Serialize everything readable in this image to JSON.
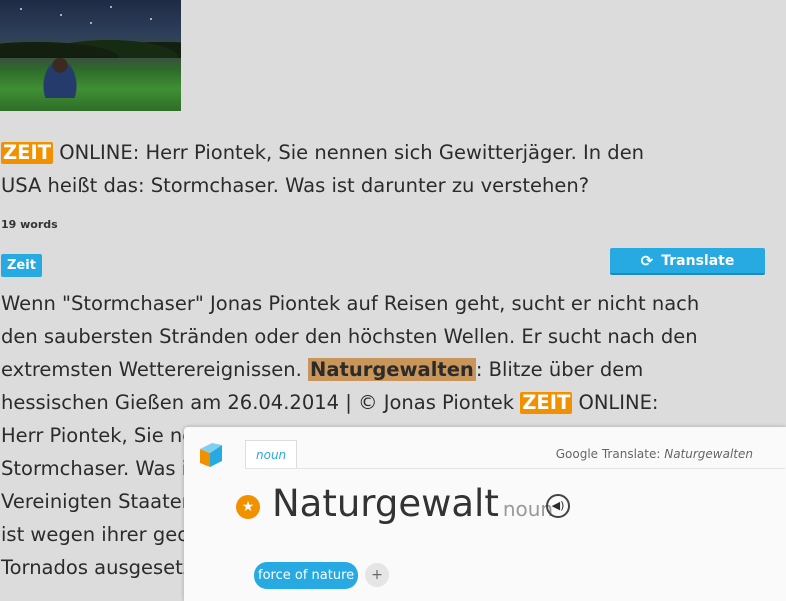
{
  "logo_text": "ZEIT",
  "intro": {
    "after_logo": "ONLINE: Herr Piontek, Sie nennen sich Gewitterjäger. In den USA heißt das: Stormchaser. Was ist darunter zu verstehen?"
  },
  "word_count": "19 words",
  "tag": "Zeit",
  "translate_button": "Translate",
  "article": {
    "part1": "Wenn \"Stormchaser\" Jonas Piontek auf Reisen geht, sucht er nicht nach den saubersten Stränden oder den höchsten Wellen. Er sucht nach den extremsten Wetterereignissen. ",
    "highlight": "Naturgewalten",
    "part2": ": Blitze über dem hessischen Gießen am 26.04.2014  |  © Jonas Piontek ",
    "part3": " ONLINE: Herr Piontek, Sie nennen sich Gewitterjäger. In den USA heißt das: Stormchaser. Was ist darunter zu verstehen? Der Begriff wurde in den Vereinigten Staaten geprägt, speziell im Mittleren Westen. Die Gegend ist wegen ihrer geografischen Lage häufig zu schweren Unwettern und Tornados ausgesetzt. Ein Stormchaser beschäftigt sich"
  },
  "popup": {
    "tab_label": "noun",
    "source_prefix": "Google Translate: ",
    "source_word": "Naturgewalten",
    "headword": "Naturgewalt",
    "part_of_speech": "noun",
    "translation": "force of nature",
    "add_symbol": "+",
    "icons": {
      "logo": "book-logo-icon",
      "star": "star-icon",
      "audio": "speaker-icon",
      "translate": "refresh-icon"
    }
  },
  "colors": {
    "accent": "#27aae1",
    "zeit_orange": "#f29100",
    "highlight": "#c8965a"
  }
}
